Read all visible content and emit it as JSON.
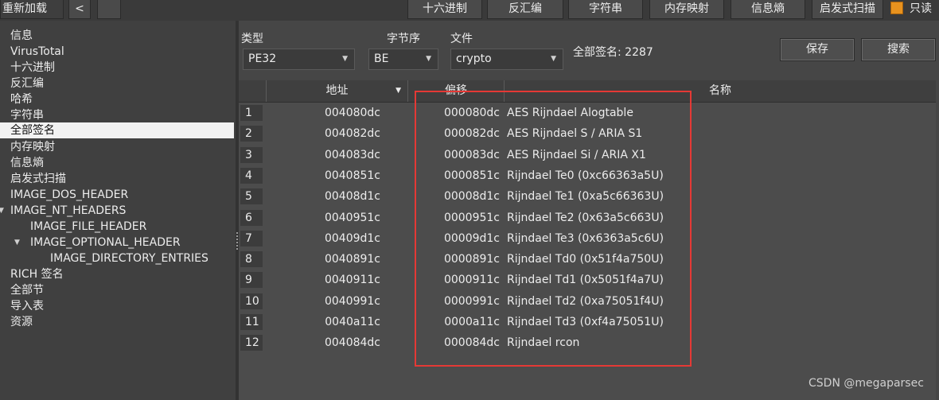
{
  "toolbar": {
    "reload_label": "重新加载",
    "back_label": "<",
    "tabs": [
      "十六进制",
      "反汇编",
      "字符串",
      "内存映射",
      "信息熵",
      "启发式扫描"
    ],
    "readonly_label": "只读",
    "readonly_checked": true,
    "readonly_color": "#e8921e"
  },
  "sidebar": {
    "items": [
      {
        "label": "信息"
      },
      {
        "label": "VirusTotal"
      },
      {
        "label": "十六进制"
      },
      {
        "label": "反汇编"
      },
      {
        "label": "哈希"
      },
      {
        "label": "字符串"
      },
      {
        "label": "全部签名",
        "selected": true
      },
      {
        "label": "内存映射"
      },
      {
        "label": "信息熵"
      },
      {
        "label": "启发式扫描"
      },
      {
        "label": "IMAGE_DOS_HEADER"
      },
      {
        "label": "IMAGE_NT_HEADERS",
        "expanded": true
      },
      {
        "label": "IMAGE_FILE_HEADER"
      },
      {
        "label": "IMAGE_OPTIONAL_HEADER",
        "expanded": true
      },
      {
        "label": "IMAGE_DIRECTORY_ENTRIES"
      },
      {
        "label": "RICH 签名"
      },
      {
        "label": "全部节"
      },
      {
        "label": "导入表"
      },
      {
        "label": "资源"
      }
    ]
  },
  "filters": {
    "type_label": "类型",
    "type_value": "PE32",
    "endian_label": "字节序",
    "endian_value": "BE",
    "file_label": "文件",
    "file_value": "crypto"
  },
  "total_signatures": "全部签名: 2287",
  "actions": {
    "save_label": "保存",
    "search_label": "搜索"
  },
  "table": {
    "columns": [
      "地址",
      "偏移",
      "名称"
    ],
    "rows": [
      {
        "num": "1",
        "address": "004080dc",
        "offset": "000080dc",
        "name": "AES Rijndael Alogtable"
      },
      {
        "num": "2",
        "address": "004082dc",
        "offset": "000082dc",
        "name": "AES Rijndael S / ARIA S1"
      },
      {
        "num": "3",
        "address": "004083dc",
        "offset": "000083dc",
        "name": "AES Rijndael Si / ARIA X1"
      },
      {
        "num": "4",
        "address": "0040851c",
        "offset": "0000851c",
        "name": "Rijndael Te0 (0xc66363a5U)"
      },
      {
        "num": "5",
        "address": "00408d1c",
        "offset": "00008d1c",
        "name": "Rijndael Te1 (0xa5c66363U)"
      },
      {
        "num": "6",
        "address": "0040951c",
        "offset": "0000951c",
        "name": "Rijndael Te2 (0x63a5c663U)"
      },
      {
        "num": "7",
        "address": "00409d1c",
        "offset": "00009d1c",
        "name": "Rijndael Te3 (0x6363a5c6U)"
      },
      {
        "num": "8",
        "address": "0040891c",
        "offset": "0000891c",
        "name": "Rijndael Td0 (0x51f4a750U)"
      },
      {
        "num": "9",
        "address": "0040911c",
        "offset": "0000911c",
        "name": "Rijndael Td1 (0x5051f4a7U)"
      },
      {
        "num": "10",
        "address": "0040991c",
        "offset": "0000991c",
        "name": "Rijndael Td2 (0xa75051f4U)"
      },
      {
        "num": "11",
        "address": "0040a11c",
        "offset": "0000a11c",
        "name": "Rijndael Td3 (0xf4a75051U)"
      },
      {
        "num": "12",
        "address": "004084dc",
        "offset": "000084dc",
        "name": "Rijndael rcon"
      }
    ]
  },
  "annotation_color": "#e53935",
  "watermark": "CSDN @megaparsec"
}
